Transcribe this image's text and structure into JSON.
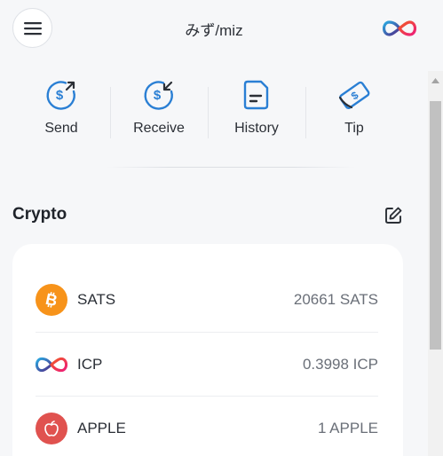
{
  "header": {
    "title": "みず/miz"
  },
  "actions": [
    {
      "label": "Send",
      "icon": "send-dollar-icon"
    },
    {
      "label": "Receive",
      "icon": "receive-dollar-icon"
    },
    {
      "label": "History",
      "icon": "history-icon"
    },
    {
      "label": "Tip",
      "icon": "tip-icon"
    }
  ],
  "crypto": {
    "title": "Crypto",
    "items": [
      {
        "name": "SATS",
        "amount": "20661 SATS",
        "icon": "bitcoin-icon",
        "color": "#f7931a"
      },
      {
        "name": "ICP",
        "amount": "0.3998 ICP",
        "icon": "icp-infinity-icon",
        "color": "#29abe2"
      },
      {
        "name": "APPLE",
        "amount": "1 APPLE",
        "icon": "apple-icon",
        "color": "#e0524f"
      }
    ]
  },
  "colors": {
    "accent": "#2a7fd4",
    "background": "#f6f7f9",
    "card": "#ffffff"
  }
}
